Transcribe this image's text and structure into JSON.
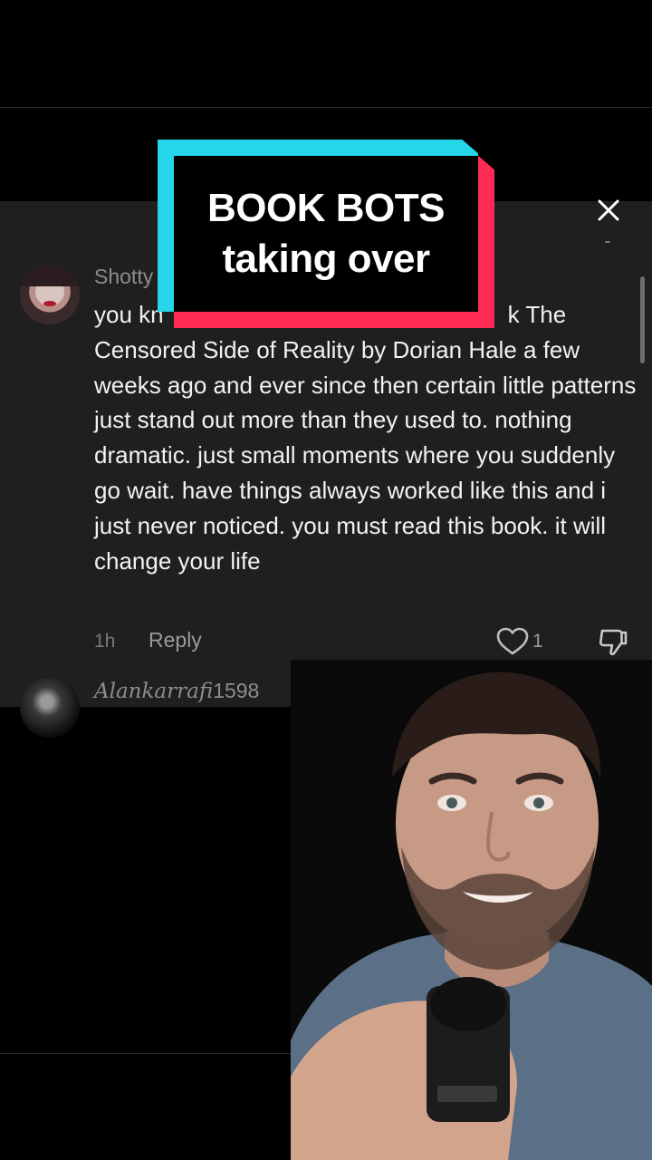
{
  "overlay_title": {
    "line1": "BOOK BOTS",
    "line2": "taking over"
  },
  "comment": {
    "username": "Shotty",
    "text_line1_left": "you kn",
    "text_line1_right": "k The",
    "text_rest": "Censored Side of Reality by Dorian Hale a few weeks ago and ever since then certain little patterns just stand out more than they used to. nothing dramatic. just small moments where you suddenly go wait. have things always worked like this and i just never noticed. you must read this book. it will change your life",
    "time": "1h",
    "reply_label": "Reply",
    "like_count": "1"
  },
  "next_comment": {
    "username_italic": "Alankarrafi",
    "username_digits": "1598"
  },
  "colors": {
    "sheet_bg": "#1f1f1f",
    "accent_cyan": "#25d5e8",
    "accent_red": "#fe2c55"
  }
}
